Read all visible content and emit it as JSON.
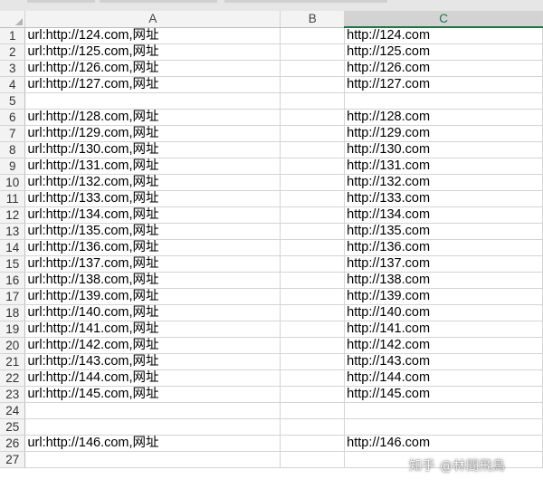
{
  "sheet": {
    "columns": [
      "A",
      "B",
      "C"
    ],
    "selected_column": "C",
    "rows": [
      {
        "n": "1",
        "a": "url:http://124.com,网址",
        "b": "",
        "c": "http://124.com"
      },
      {
        "n": "2",
        "a": "url:http://125.com,网址",
        "b": "",
        "c": "http://125.com"
      },
      {
        "n": "3",
        "a": "url:http://126.com,网址",
        "b": "",
        "c": "http://126.com"
      },
      {
        "n": "4",
        "a": "url:http://127.com,网址",
        "b": "",
        "c": "http://127.com"
      },
      {
        "n": "5",
        "a": "",
        "b": "",
        "c": ""
      },
      {
        "n": "6",
        "a": "url:http://128.com,网址",
        "b": "",
        "c": "http://128.com"
      },
      {
        "n": "7",
        "a": "url:http://129.com,网址",
        "b": "",
        "c": "http://129.com"
      },
      {
        "n": "8",
        "a": "url:http://130.com,网址",
        "b": "",
        "c": "http://130.com"
      },
      {
        "n": "9",
        "a": "url:http://131.com,网址",
        "b": "",
        "c": "http://131.com"
      },
      {
        "n": "10",
        "a": "url:http://132.com,网址",
        "b": "",
        "c": "http://132.com"
      },
      {
        "n": "11",
        "a": "url:http://133.com,网址",
        "b": "",
        "c": "http://133.com"
      },
      {
        "n": "12",
        "a": "url:http://134.com,网址",
        "b": "",
        "c": "http://134.com"
      },
      {
        "n": "13",
        "a": "url:http://135.com,网址",
        "b": "",
        "c": "http://135.com"
      },
      {
        "n": "14",
        "a": "url:http://136.com,网址",
        "b": "",
        "c": "http://136.com"
      },
      {
        "n": "15",
        "a": "url:http://137.com,网址",
        "b": "",
        "c": "http://137.com"
      },
      {
        "n": "16",
        "a": "url:http://138.com,网址",
        "b": "",
        "c": "http://138.com"
      },
      {
        "n": "17",
        "a": "url:http://139.com,网址",
        "b": "",
        "c": "http://139.com"
      },
      {
        "n": "18",
        "a": "url:http://140.com,网址",
        "b": "",
        "c": "http://140.com"
      },
      {
        "n": "19",
        "a": "url:http://141.com,网址",
        "b": "",
        "c": "http://141.com"
      },
      {
        "n": "20",
        "a": "url:http://142.com,网址",
        "b": "",
        "c": "http://142.com"
      },
      {
        "n": "21",
        "a": "url:http://143.com,网址",
        "b": "",
        "c": "http://143.com"
      },
      {
        "n": "22",
        "a": "url:http://144.com,网址",
        "b": "",
        "c": "http://144.com"
      },
      {
        "n": "23",
        "a": "url:http://145.com,网址",
        "b": "",
        "c": "http://145.com"
      },
      {
        "n": "24",
        "a": "",
        "b": "",
        "c": ""
      },
      {
        "n": "25",
        "a": "",
        "b": "",
        "c": ""
      },
      {
        "n": "26",
        "a": "url:http://146.com,网址",
        "b": "",
        "c": "http://146.com"
      },
      {
        "n": "27",
        "a": "",
        "b": "",
        "c": ""
      }
    ]
  },
  "watermark": "知乎 @林間飛鳥",
  "colors": {
    "accent": "#217346",
    "gridline": "#d4d4d4",
    "header_bg": "#f3f3f3"
  }
}
